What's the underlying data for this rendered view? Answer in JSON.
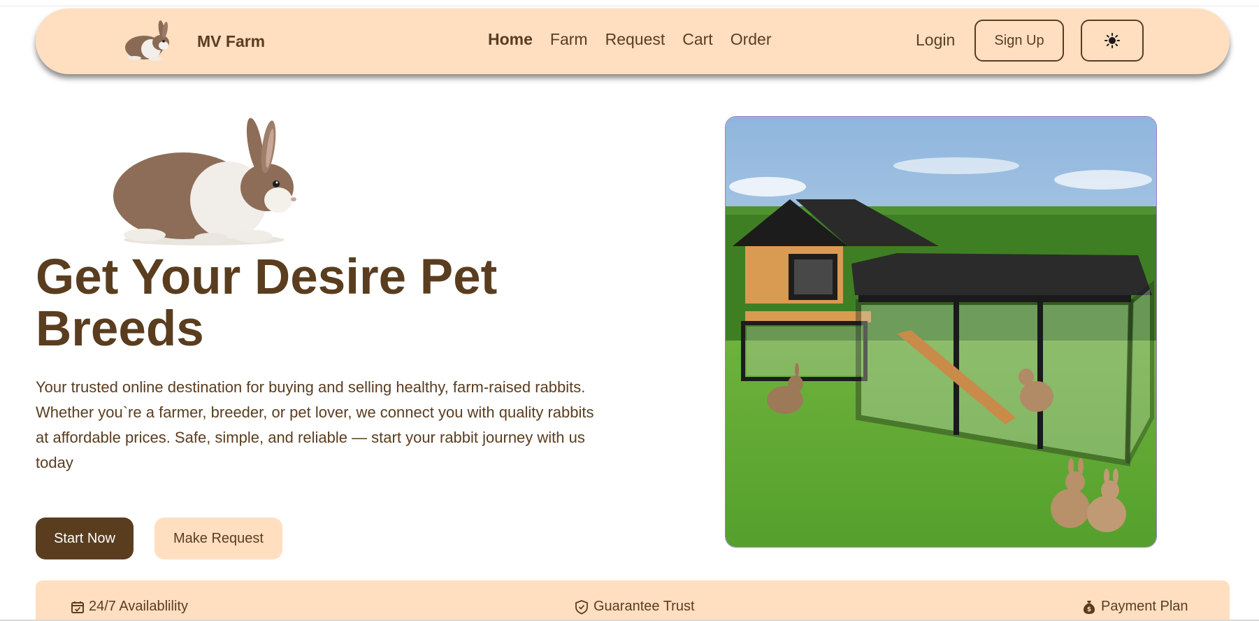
{
  "nav": {
    "brand_name": "MV Farm",
    "links": [
      "Home",
      "Farm",
      "Request",
      "Cart",
      "Order"
    ],
    "active_link": "Home",
    "login_label": "Login",
    "signup_label": "Sign Up",
    "theme_icon": "sun-icon"
  },
  "hero": {
    "title": "Get Your Desire Pet Breeds",
    "description": "Your trusted online destination for buying and selling healthy, farm-raised rabbits. Whether you`re a farmer, breeder, or pet lover, we connect you with quality rabbits at affordable prices. Safe, simple, and reliable — start your rabbit journey with us today",
    "start_button": "Start Now",
    "request_button": "Make Request"
  },
  "features": [
    {
      "icon": "calendar-check-icon",
      "label": "24/7 Availablility"
    },
    {
      "icon": "shield-check-icon",
      "label": "Guarantee Trust"
    },
    {
      "icon": "money-bag-icon",
      "label": "Payment Plan"
    }
  ],
  "colors": {
    "brand_brown": "#5a3d1f",
    "peach": "#ffdfc0",
    "background": "#ffffff"
  }
}
